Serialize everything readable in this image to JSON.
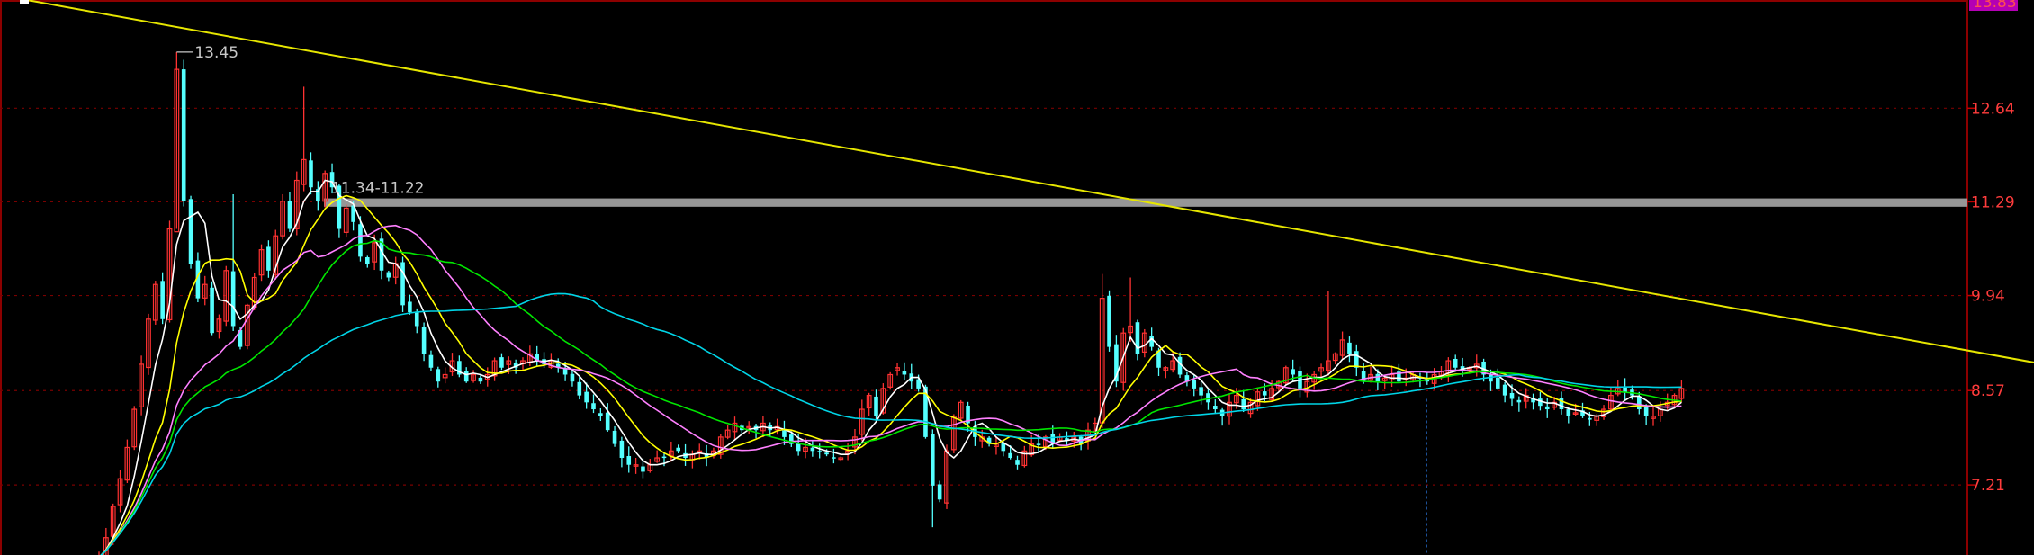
{
  "chart_data": {
    "type": "candlestick",
    "y_axis": {
      "side": "right",
      "max_label": "13.83",
      "ticks": [
        {
          "value": 12.64,
          "label": "12.64"
        },
        {
          "value": 11.29,
          "label": "11.29"
        },
        {
          "value": 9.94,
          "label": "9.94"
        },
        {
          "value": 8.57,
          "label": "8.57"
        },
        {
          "value": 7.21,
          "label": "7.21"
        }
      ],
      "ylim": [
        6.2,
        14.2
      ],
      "grid": true
    },
    "annotations": {
      "peak_label": "13.45",
      "peak_value": 13.45,
      "zone_label": "11.34-11.22",
      "zone_high": 11.34,
      "zone_low": 11.22
    },
    "trendline": {
      "start": [
        0,
        14.2
      ],
      "end": [
        288,
        8.7
      ]
    },
    "colors": {
      "background": "#000000",
      "up": "#ff3232",
      "down": "#54ffff",
      "ma5": "#ffffff",
      "ma10": "#ffff00",
      "ma20": "#ff80ff",
      "ma30": "#00e600",
      "ma60": "#00d4e6",
      "trendline": "#e6e600",
      "zone": "#969696",
      "axis_text": "#ff3c3c",
      "max_label_bg": "#b400b4",
      "max_label_text": "#ff5050"
    },
    "series": [
      {
        "name": "MA5",
        "line": "ma5",
        "period": 5
      },
      {
        "name": "MA10",
        "line": "ma10",
        "period": 10
      },
      {
        "name": "MA20",
        "line": "ma20",
        "period": 20
      },
      {
        "name": "MA30",
        "line": "ma30",
        "period": 30
      },
      {
        "name": "MA60",
        "line": "ma60",
        "period": 60
      }
    ],
    "closes": [
      6.15,
      6.45,
      6.9,
      7.3,
      7.75,
      8.3,
      8.95,
      9.6,
      10.1,
      9.6,
      10.9,
      13.2,
      11.3,
      10.4,
      9.9,
      10.1,
      9.4,
      9.6,
      10.3,
      9.5,
      9.2,
      9.8,
      10.2,
      10.6,
      10.3,
      10.8,
      11.3,
      10.9,
      11.6,
      11.9,
      11.5,
      11.3,
      11.7,
      11.5,
      10.9,
      11.2,
      11.0,
      10.5,
      10.4,
      10.7,
      10.3,
      10.2,
      10.4,
      9.8,
      9.7,
      9.5,
      9.1,
      8.9,
      8.7,
      8.8,
      9.0,
      8.8,
      8.7,
      8.8,
      8.7,
      8.8,
      9.0,
      8.9,
      9.0,
      8.9,
      9.0,
      9.1,
      9.0,
      8.95,
      9.0,
      8.9,
      8.8,
      8.7,
      8.5,
      8.4,
      8.3,
      8.2,
      8.0,
      7.8,
      7.6,
      7.5,
      7.5,
      7.4,
      7.5,
      7.6,
      7.6,
      7.7,
      7.7,
      7.6,
      7.65,
      7.7,
      7.6,
      7.7,
      7.9,
      8.0,
      8.1,
      8.0,
      8.05,
      8.0,
      8.1,
      8.0,
      8.05,
      7.9,
      7.8,
      7.7,
      7.75,
      7.7,
      7.7,
      7.65,
      7.6,
      7.6,
      7.7,
      7.9,
      8.3,
      8.5,
      8.2,
      8.6,
      8.8,
      8.9,
      8.8,
      8.7,
      8.6,
      7.9,
      7.2,
      7.0,
      7.7,
      8.2,
      8.4,
      8.1,
      7.9,
      7.9,
      7.8,
      7.8,
      7.7,
      7.6,
      7.5,
      7.7,
      7.8,
      7.8,
      7.9,
      7.8,
      7.9,
      7.85,
      7.9,
      7.8,
      8.0,
      8.1,
      9.9,
      9.2,
      8.7,
      9.4,
      9.5,
      9.1,
      9.4,
      9.2,
      8.9,
      8.9,
      9.0,
      8.8,
      8.7,
      8.6,
      8.5,
      8.4,
      8.3,
      8.2,
      8.4,
      8.5,
      8.3,
      8.4,
      8.55,
      8.5,
      8.6,
      8.7,
      8.9,
      8.8,
      8.6,
      8.7,
      8.8,
      8.9,
      9.0,
      9.1,
      9.3,
      9.1,
      8.9,
      8.7,
      8.8,
      8.7,
      8.75,
      8.8,
      8.7,
      8.75,
      8.8,
      8.75,
      8.7,
      8.8,
      8.85,
      9.0,
      8.9,
      8.85,
      8.9,
      8.95,
      8.8,
      8.7,
      8.6,
      8.5,
      8.45,
      8.4,
      8.5,
      8.4,
      8.35,
      8.3,
      8.4,
      8.3,
      8.2,
      8.25,
      8.2,
      8.15,
      8.2,
      8.3,
      8.5,
      8.6,
      8.55,
      8.5,
      8.3,
      8.2,
      8.2,
      8.3,
      8.4,
      8.5,
      8.6
    ]
  }
}
